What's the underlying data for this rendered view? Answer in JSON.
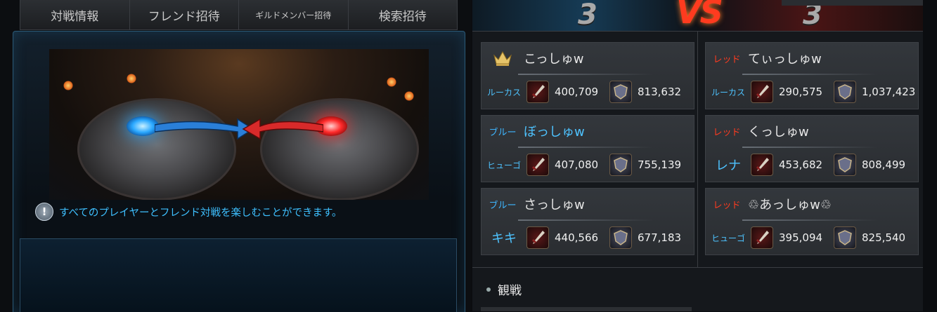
{
  "tabs": [
    {
      "label": "対戦情報"
    },
    {
      "label": "フレンド招待"
    },
    {
      "label": "ギルドメンバー招待"
    },
    {
      "label": "検索招待"
    }
  ],
  "notice": "すべてのプレイヤーとフレンド対戦を楽しむことができます。",
  "score": {
    "left": "3",
    "vs": "VS",
    "right": "3"
  },
  "blue_team": [
    {
      "label": "",
      "leader": true,
      "name": "こっしゅw",
      "class": "ルーカス",
      "attack": "400,709",
      "defense": "813,632"
    },
    {
      "label": "ブルー",
      "leader": false,
      "name": "ぼっしゅw",
      "class": "ヒューゴ",
      "attack": "407,080",
      "defense": "755,139"
    },
    {
      "label": "ブルー",
      "leader": false,
      "name": "さっしゅw",
      "class": "キキ",
      "attack": "440,566",
      "defense": "677,183"
    }
  ],
  "red_team": [
    {
      "label": "レッド",
      "name": "てぃっしゅw",
      "class": "ルーカス",
      "attack": "290,575",
      "defense": "1,037,423"
    },
    {
      "label": "レッド",
      "name": "くっしゅw",
      "class": "レナ",
      "attack": "453,682",
      "defense": "808,499"
    },
    {
      "label": "レッド",
      "name": "♲あっしゅw♲",
      "class": "ヒューゴ",
      "attack": "395,094",
      "defense": "825,540"
    }
  ],
  "spectate_label": "観戦",
  "colors": {
    "blue": "#4ec3ff",
    "red": "#ff3b1f",
    "vs": "#ff3b1f"
  }
}
